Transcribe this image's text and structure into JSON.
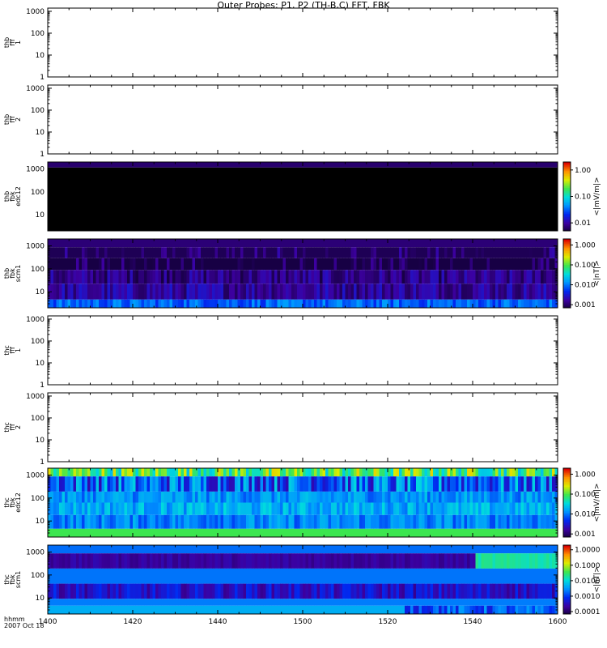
{
  "title": "Outer Probes: P1, P2 (TH-B,C) FFT, FBK",
  "x_axis": {
    "label_line1": "hhmm",
    "label_line2": "2007 Oct 18",
    "ticks": [
      "1400",
      "1420",
      "1440",
      "1500",
      "1520",
      "1540",
      "1600"
    ]
  },
  "chart_data": [
    {
      "type": "heatmap",
      "ylabel": [
        "thb",
        "fff",
        "1"
      ],
      "y_ticks": [
        "1",
        "10",
        "100",
        "1000"
      ],
      "y_scale": "log",
      "ylim": [
        1,
        1400
      ],
      "has_data": false
    },
    {
      "type": "heatmap",
      "ylabel": [
        "thb",
        "fff",
        "2"
      ],
      "y_ticks": [
        "1",
        "10",
        "100",
        "1000"
      ],
      "y_scale": "log",
      "ylim": [
        1,
        1400
      ],
      "has_data": false
    },
    {
      "type": "heatmap",
      "ylabel": [
        "thb",
        "fbk",
        "edc12"
      ],
      "y_ticks": [
        "10",
        "100",
        "1000"
      ],
      "y_scale": "log",
      "ylim": [
        2,
        2000
      ],
      "has_data": true,
      "colorbar": {
        "ticks": [
          "1.00",
          "0.10",
          "0.01"
        ],
        "label": "<|mV/m|>",
        "scale": "log",
        "range": [
          0.005,
          2.0
        ]
      },
      "bands": [
        [
          0.92,
          1.0,
          0.06,
          "uniform"
        ],
        [
          0.0,
          0.92,
          0.0,
          "uniform"
        ]
      ]
    },
    {
      "type": "heatmap",
      "ylabel": [
        "thb",
        "fbk",
        "scm1"
      ],
      "y_ticks": [
        "10",
        "100",
        "1000"
      ],
      "y_scale": "log",
      "ylim": [
        2,
        2000
      ],
      "has_data": true,
      "colorbar": {
        "ticks": [
          "1.000",
          "0.100",
          "0.010",
          "0.001"
        ],
        "label": "<|nT|>",
        "scale": "log",
        "range": [
          0.0007,
          2.0
        ]
      },
      "bands": [
        [
          0.88,
          1.0,
          0.07,
          "uniform"
        ],
        [
          0.72,
          0.88,
          0.03,
          "stripes"
        ],
        [
          0.55,
          0.72,
          0.01,
          "stripes"
        ],
        [
          0.35,
          0.55,
          0.09,
          "noisy"
        ],
        [
          0.12,
          0.35,
          0.12,
          "noisy"
        ],
        [
          0.0,
          0.12,
          0.32,
          "noisy"
        ]
      ]
    },
    {
      "type": "heatmap",
      "ylabel": [
        "thc",
        "fff",
        "1"
      ],
      "y_ticks": [
        "1",
        "10",
        "100",
        "1000"
      ],
      "y_scale": "log",
      "ylim": [
        1,
        1400
      ],
      "has_data": false
    },
    {
      "type": "heatmap",
      "ylabel": [
        "thc",
        "fff",
        "2"
      ],
      "y_ticks": [
        "1",
        "10",
        "100",
        "1000"
      ],
      "y_scale": "log",
      "ylim": [
        1,
        1400
      ],
      "has_data": false
    },
    {
      "type": "heatmap",
      "ylabel": [
        "thc",
        "fbk",
        "edc12"
      ],
      "y_ticks": [
        "10",
        "100",
        "1000"
      ],
      "y_scale": "log",
      "ylim": [
        2,
        2000
      ],
      "has_data": true,
      "colorbar": {
        "ticks": [
          "1.000",
          "0.100",
          "0.010",
          "0.001"
        ],
        "label": "<|mV/m|>",
        "scale": "log",
        "range": [
          0.0007,
          2.0
        ]
      },
      "bands": [
        [
          0.88,
          1.0,
          0.55,
          "bright"
        ],
        [
          0.66,
          0.88,
          0.25,
          "bright"
        ],
        [
          0.5,
          0.66,
          0.38,
          "noisy"
        ],
        [
          0.32,
          0.5,
          0.42,
          "noisy"
        ],
        [
          0.12,
          0.32,
          0.36,
          "noisy"
        ],
        [
          0.0,
          0.12,
          0.62,
          "uniform"
        ]
      ]
    },
    {
      "type": "heatmap",
      "ylabel": [
        "thc",
        "fbk",
        "scm1"
      ],
      "y_ticks": [
        "10",
        "100",
        "1000"
      ],
      "y_scale": "log",
      "ylim": [
        2,
        2000
      ],
      "has_data": true,
      "colorbar": {
        "ticks": [
          "1.0000",
          "0.1000",
          "0.0100",
          "0.0010",
          "0.0001"
        ],
        "label": "<|nT|>",
        "scale": "log",
        "range": [
          7e-05,
          2.0
        ]
      },
      "bands": [
        [
          0.88,
          1.0,
          0.33,
          "uniform"
        ],
        [
          0.66,
          0.88,
          0.12,
          "late"
        ],
        [
          0.44,
          0.66,
          0.34,
          "uniform"
        ],
        [
          0.22,
          0.44,
          0.18,
          "noisy"
        ],
        [
          0.12,
          0.22,
          0.35,
          "uniform"
        ],
        [
          0.0,
          0.12,
          0.42,
          "end"
        ]
      ]
    }
  ]
}
